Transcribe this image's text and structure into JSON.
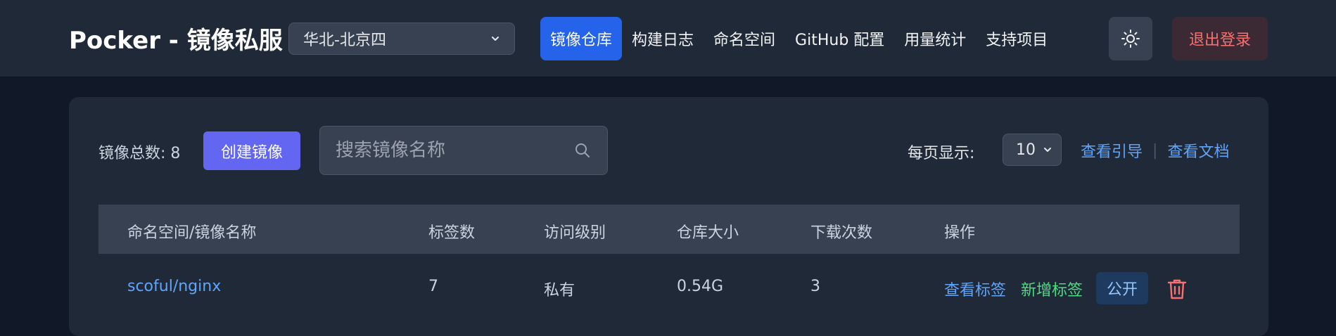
{
  "header": {
    "brand": "Pocker - 镜像私服",
    "region": "华北-北京四",
    "nav": [
      {
        "label": "镜像仓库",
        "active": true
      },
      {
        "label": "构建日志",
        "active": false
      },
      {
        "label": "命名空间",
        "active": false
      },
      {
        "label": "GitHub 配置",
        "active": false
      },
      {
        "label": "用量统计",
        "active": false
      },
      {
        "label": "支持项目",
        "active": false
      }
    ],
    "theme_icon": "sun-icon",
    "logout_label": "退出登录"
  },
  "toolbar": {
    "total_label": "镜像总数: 8",
    "create_label": "创建镜像",
    "search_placeholder": "搜索镜像名称",
    "per_page_label": "每页显示:",
    "per_page_value": "10",
    "guide_link": "查看引导",
    "docs_link": "查看文档"
  },
  "table": {
    "columns": [
      "命名空间/镜像名称",
      "标签数",
      "访问级别",
      "仓库大小",
      "下载次数",
      "操作"
    ],
    "rows": [
      {
        "name": "scoful/nginx",
        "tags": "7",
        "access": "私有",
        "size": "0.54G",
        "downloads": "3",
        "op_view": "查看标签",
        "op_add": "新增标签",
        "op_public": "公开"
      }
    ]
  },
  "colors": {
    "accent": "#2563eb",
    "create": "#6366f1",
    "link": "#60a5fa",
    "success": "#4ade80",
    "danger": "#f87171"
  }
}
